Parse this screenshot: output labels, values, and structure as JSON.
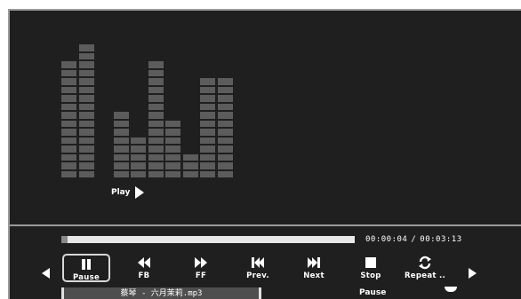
{
  "player": {
    "status_label": "Play",
    "time_elapsed": "00:00:04",
    "time_separator": "/",
    "time_total": "00:03:13",
    "progress": 0.02,
    "filename": "蔡琴 - 六月茉莉.mp3",
    "state_text": "Pause"
  },
  "spectrum": {
    "columns": [
      14,
      16,
      0,
      8,
      5,
      14,
      7,
      3,
      12,
      12
    ],
    "color": "#5c5c5c"
  },
  "controls": [
    {
      "label": "Pause",
      "icon": "pause-icon",
      "selected": true
    },
    {
      "label": "FB",
      "icon": "fast-backward-icon",
      "selected": false
    },
    {
      "label": "FF",
      "icon": "fast-forward-icon",
      "selected": false
    },
    {
      "label": "Prev.",
      "icon": "previous-track-icon",
      "selected": false
    },
    {
      "label": "Next",
      "icon": "next-track-icon",
      "selected": false
    },
    {
      "label": "Stop",
      "icon": "stop-icon",
      "selected": false
    },
    {
      "label": "Repeat ..",
      "icon": "repeat-icon",
      "selected": false
    }
  ],
  "colors": {
    "background": "#1f1f1f",
    "text": "#ffffff",
    "progress_track": "#e8e8e8"
  }
}
